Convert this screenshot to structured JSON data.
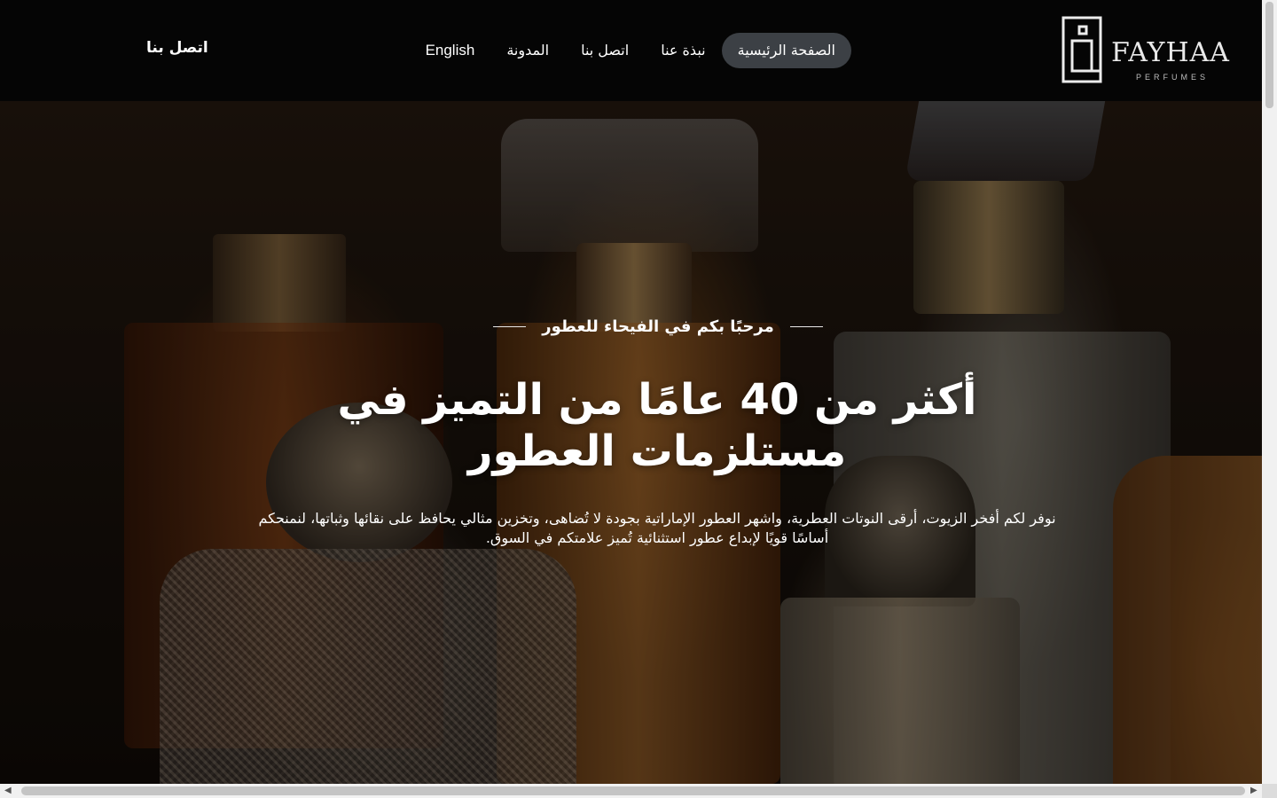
{
  "brand": {
    "wordmark": "FAYHAA",
    "subtitle": "PERFUMES"
  },
  "nav": {
    "items": [
      {
        "label": "الصفحة الرئيسية",
        "active": true
      },
      {
        "label": "نبذة عنا"
      },
      {
        "label": "اتصل بنا"
      },
      {
        "label": "المدونة"
      },
      {
        "label": "English"
      }
    ],
    "contact_link": "اتصل بنا"
  },
  "hero": {
    "tagline": "مرحبًا بكم في الفيحاء للعطور",
    "headline": "أكثر من 40 عامًا من التميز في مستلزمات العطور",
    "description": "نوفر لكم أفخر الزيوت، أرقى النوتات العطرية، واشهر العطور الإماراتية بجودة لا تُضاهى، وتخزين مثالي يحافظ على نقائها وثباتها، لنمنحكم أساسًا قويًا لإبداع عطور استثنائية تُميز علامتكم في السوق."
  },
  "colors": {
    "header_bg": "#050505",
    "active_pill": "#3c4045",
    "text": "#ffffff"
  }
}
